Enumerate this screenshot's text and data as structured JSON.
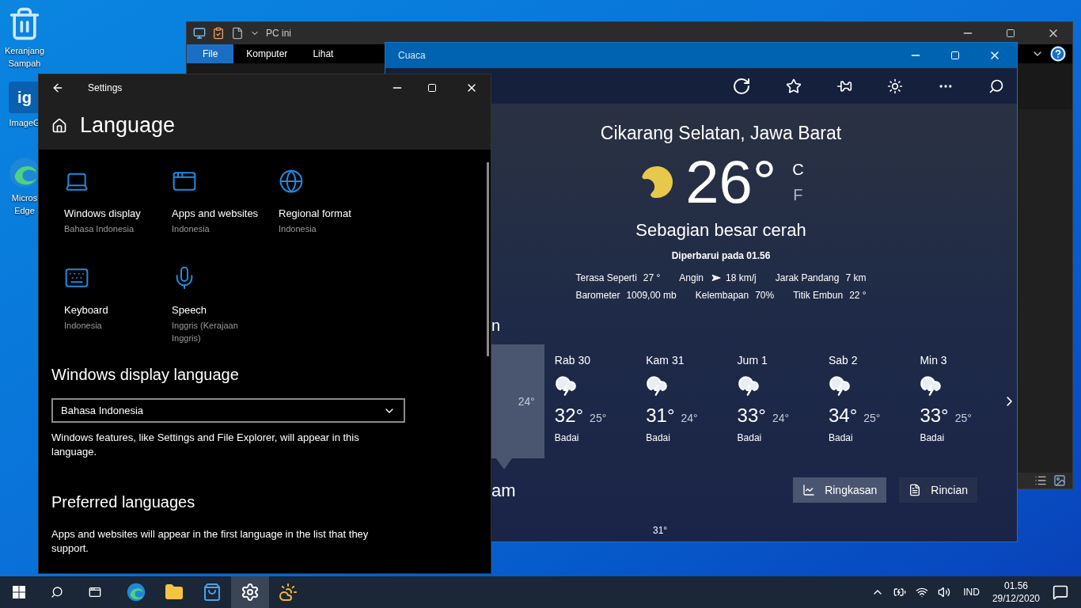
{
  "desktop_icons": [
    {
      "kind": "recycle",
      "lines": [
        "Keranjang",
        "Sampah"
      ]
    },
    {
      "kind": "imageg",
      "logo_text": "ig",
      "lines": [
        "ImageG"
      ]
    },
    {
      "kind": "edge",
      "lines": [
        "Micros",
        "Edge"
      ]
    }
  ],
  "explorer": {
    "title": "PC ini",
    "tabs": [
      {
        "label": "File",
        "selected": true
      },
      {
        "label": "Komputer",
        "selected": false
      },
      {
        "label": "Lihat",
        "selected": false
      }
    ]
  },
  "weather": {
    "title": "Cuaca",
    "location": "Cikarang Selatan, Jawa Barat",
    "temperature": "26°",
    "units": [
      {
        "label": "C",
        "selected": true
      },
      {
        "label": "F",
        "selected": false
      }
    ],
    "condition": "Sebagian besar cerah",
    "updated": "Diperbarui pada 01.56",
    "details": [
      [
        {
          "kind": "plain",
          "label": "Terasa Seperti",
          "value": "27 °"
        },
        {
          "kind": "wind",
          "label": "Angin",
          "value": "18 km/j"
        },
        {
          "kind": "plain",
          "label": "Jarak Pandang",
          "value": "7 km"
        }
      ],
      [
        {
          "kind": "plain",
          "label": "Barometer",
          "value": "1009,00 mb"
        },
        {
          "kind": "plain",
          "label": "Kelembapan",
          "value": "70%"
        },
        {
          "kind": "plain",
          "label": "Titik Embun",
          "value": "22 °"
        }
      ]
    ],
    "section_heading_fragment": "n",
    "days": [
      {
        "low": "24°",
        "selected": true
      },
      {
        "day": "Rab 30",
        "high": "32°",
        "low": "25°",
        "condition": "Badai",
        "selected": false
      },
      {
        "day": "Kam 31",
        "high": "31°",
        "low": "24°",
        "condition": "Badai",
        "selected": false
      },
      {
        "day": "Jum 1",
        "high": "33°",
        "low": "24°",
        "condition": "Badai",
        "selected": false
      },
      {
        "day": "Sab 2",
        "high": "34°",
        "low": "25°",
        "condition": "Badai",
        "selected": false
      },
      {
        "day": "Min 3",
        "high": "33°",
        "low": "25°",
        "condition": "Badai",
        "selected": false
      }
    ],
    "hourly_heading_fragment": "am",
    "views": [
      {
        "kind": "summary",
        "label": "Ringkasan",
        "selected": true
      },
      {
        "kind": "details",
        "label": "Rincian",
        "selected": false
      }
    ],
    "hourly_peek": "31°"
  },
  "settings": {
    "title": "Settings",
    "page": "Language",
    "tiles": [
      {
        "kind": "display",
        "title": "Windows display",
        "subtitle": "Bahasa Indonesia"
      },
      {
        "kind": "apps",
        "title": "Apps and websites",
        "subtitle": "Indonesia"
      },
      {
        "kind": "region",
        "title": "Regional format",
        "subtitle": "Indonesia"
      },
      {
        "kind": "keyboard",
        "title": "Keyboard",
        "subtitle": "Indonesia"
      },
      {
        "kind": "speech",
        "title": "Speech",
        "subtitle": "Inggris (Kerajaan Inggris)"
      }
    ],
    "display_language": {
      "heading": "Windows display language",
      "value": "Bahasa Indonesia",
      "note": "Windows features, like Settings and File Explorer, will appear in this language."
    },
    "preferred": {
      "heading": "Preferred languages",
      "note": "Apps and websites will appear in the first language in the list that they support."
    }
  },
  "taskbar": {
    "apps": [
      {
        "kind": "edge",
        "selected": false
      },
      {
        "kind": "explorer",
        "selected": false
      },
      {
        "kind": "store",
        "selected": false
      },
      {
        "kind": "settings",
        "selected": true
      },
      {
        "kind": "weather",
        "selected": false
      }
    ],
    "language": "IND",
    "time": "01.56",
    "date": "29/12/2020"
  }
}
